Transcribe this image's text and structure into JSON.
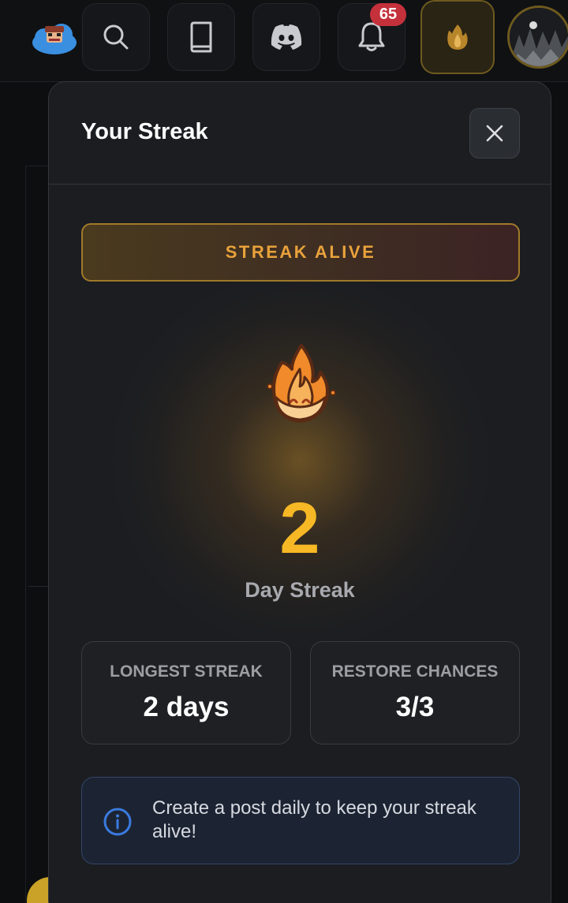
{
  "topbar": {
    "nav_icons": [
      "search-icon",
      "book-icon",
      "discord-icon",
      "bell-icon",
      "flame-icon"
    ],
    "notification_count": "65"
  },
  "modal": {
    "title": "Your Streak",
    "close_icon": "close-icon",
    "status": "STREAK ALIVE",
    "streak_count": "2",
    "streak_label": "Day Streak",
    "stats": [
      {
        "label": "LONGEST STREAK",
        "value": "2 days"
      },
      {
        "label": "RESTORE CHANCES",
        "value": "3/3"
      }
    ],
    "info": {
      "icon": "info-icon",
      "text": "Create a post daily to keep your streak alive!"
    }
  },
  "colors": {
    "accent_yellow": "#f6b824",
    "status_orange": "#e9a23b",
    "badge_red": "#c5313b",
    "info_blue": "#3b7be0"
  }
}
